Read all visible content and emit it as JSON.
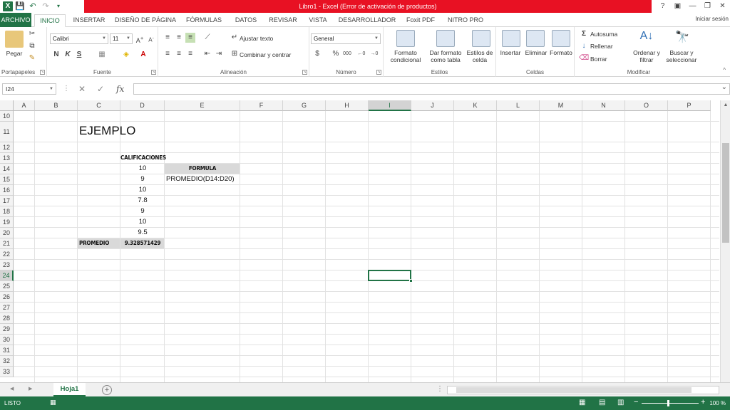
{
  "window": {
    "title": "Libro1 -  Excel (Error de activación de productos)",
    "help": "?",
    "signin": "Iniciar sesión"
  },
  "tabs": [
    "ARCHIVO",
    "INICIO",
    "INSERTAR",
    "DISEÑO DE PÁGINA",
    "FÓRMULAS",
    "DATOS",
    "REVISAR",
    "VISTA",
    "DESARROLLADOR",
    "Foxit PDF",
    "NITRO PRO"
  ],
  "ribbon": {
    "clipboard": {
      "label": "Portapapeles",
      "paste": "Pegar"
    },
    "font": {
      "label": "Fuente",
      "name": "Calibri",
      "size": "11",
      "bold": "N",
      "italic": "K",
      "underline": "S"
    },
    "alignment": {
      "label": "Alineación",
      "wrap": "Ajustar texto",
      "merge": "Combinar y centrar"
    },
    "number": {
      "label": "Número",
      "format": "General",
      "currency": "$",
      "percent": "%",
      "thousands": "000"
    },
    "styles": {
      "label": "Estilos",
      "cond": "Formato condicional",
      "table": "Dar formato como tabla",
      "cell": "Estilos de celda"
    },
    "cells": {
      "label": "Celdas",
      "insert": "Insertar",
      "delete": "Eliminar",
      "format": "Formato"
    },
    "editing": {
      "label": "Modificar",
      "autosum": "Autosuma",
      "fill": "Rellenar",
      "clear": "Borrar",
      "sort": "Ordenar y filtrar",
      "find": "Buscar y seleccionar"
    }
  },
  "formula_bar": {
    "namebox": "I24",
    "fx": "fx",
    "content": ""
  },
  "columns": [
    "A",
    "B",
    "C",
    "D",
    "E",
    "F",
    "G",
    "H",
    "I",
    "J",
    "K",
    "L",
    "M",
    "N",
    "O",
    "P"
  ],
  "rows": [
    "10",
    "11",
    "12",
    "13",
    "14",
    "15",
    "16",
    "17",
    "18",
    "19",
    "20",
    "21",
    "22",
    "23",
    "24",
    "25",
    "26",
    "27",
    "28",
    "29",
    "30",
    "31",
    "32",
    "33"
  ],
  "cells": {
    "title": "EJEMPLO",
    "header": "CALIFICACIONES",
    "grades": [
      "10",
      "9",
      "10",
      "7.8",
      "9",
      "10",
      "9.5"
    ],
    "formula_header": "FORMULA",
    "formula_text": "PROMEDIO(D14:D20)",
    "avg_label": "PROMEDIO",
    "avg_value": "9.328571429"
  },
  "sheet": {
    "name": "Hoja1"
  },
  "status": {
    "ready": "LISTO",
    "zoom": "100 %"
  },
  "colors": {
    "accent": "#217346",
    "titlebar": "#e81123",
    "header_fill": "#d9d9d9"
  }
}
